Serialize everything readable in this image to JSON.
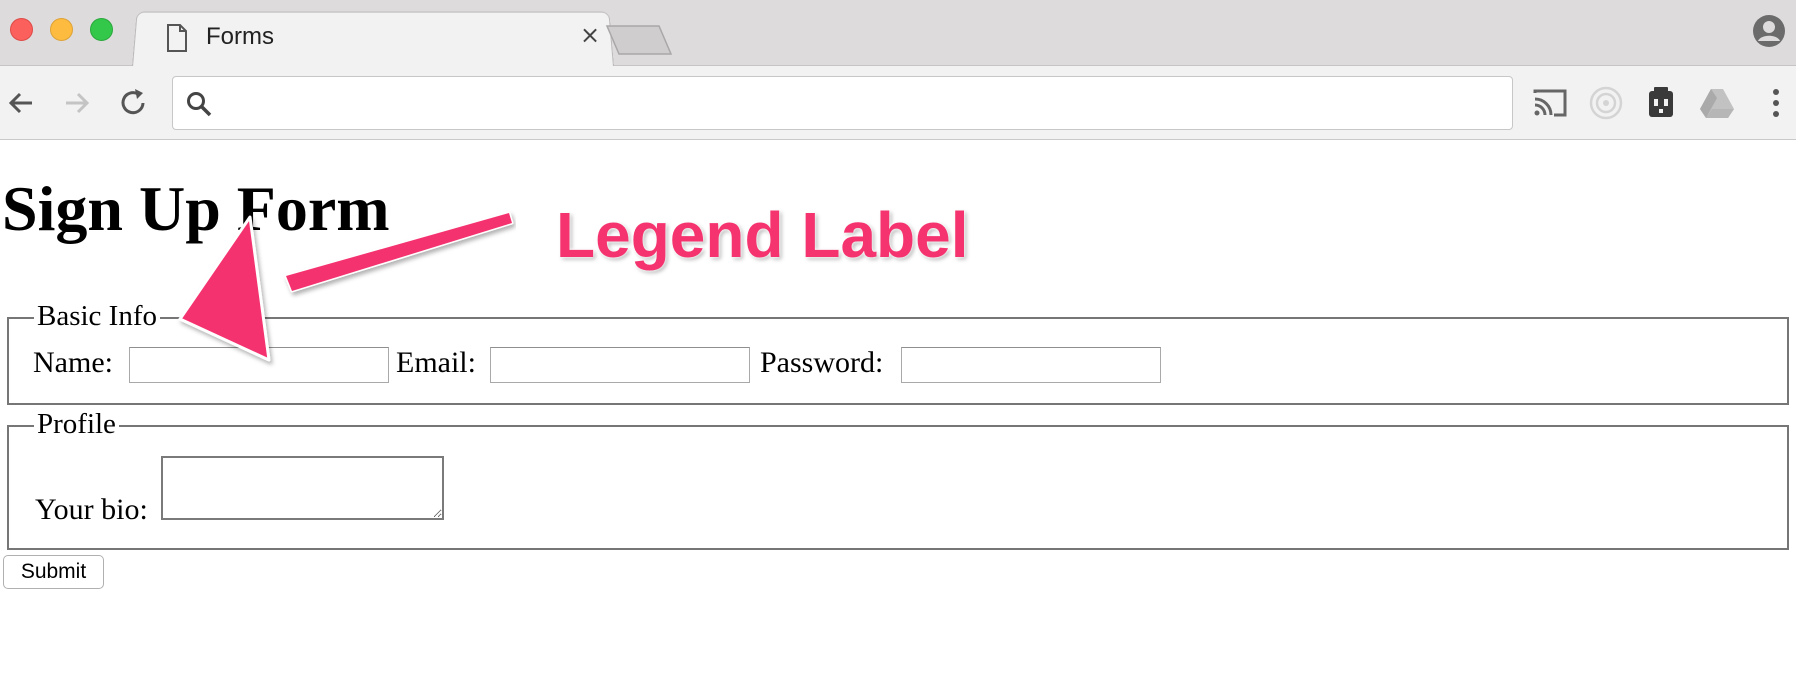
{
  "browser": {
    "tab": {
      "title": "Forms",
      "close_glyph": "×"
    },
    "omnibox": {
      "value": "",
      "placeholder": ""
    },
    "icons": [
      "page-icon",
      "profile-icon",
      "back-icon",
      "forward-icon",
      "reload-icon",
      "search-icon",
      "cast-icon",
      "extension-disc-icon",
      "extension-plug-icon",
      "drive-icon",
      "more-menu-icon"
    ]
  },
  "page": {
    "title": "Sign Up Form",
    "basic_info": {
      "legend": "Basic Info",
      "name_label": "Name:",
      "name_value": "",
      "email_label": "Email:",
      "email_value": "",
      "password_label": "Password:",
      "password_value": ""
    },
    "profile": {
      "legend": "Profile",
      "bio_label": "Your bio:",
      "bio_value": ""
    },
    "submit_label": "Submit"
  },
  "annotation": {
    "text": "Legend Label",
    "color": "#f5336f"
  }
}
